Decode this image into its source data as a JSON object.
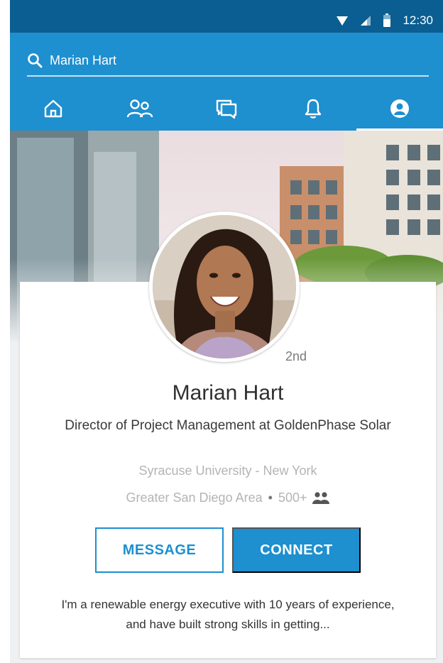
{
  "status_bar": {
    "time": "12:30",
    "icons": [
      "wifi-icon",
      "signal-icon",
      "battery-icon"
    ]
  },
  "search": {
    "value": "Marian Hart",
    "icon": "search-icon"
  },
  "nav": {
    "items": [
      {
        "icon": "home-icon"
      },
      {
        "icon": "people-icon"
      },
      {
        "icon": "messages-icon"
      },
      {
        "icon": "notifications-icon"
      },
      {
        "icon": "profile-icon",
        "active": true
      }
    ]
  },
  "profile": {
    "connection_degree": "2nd",
    "name": "Marian Hart",
    "headline": "Director of Project Management at GoldenPhase Solar",
    "education_location": "Syracuse University - New York",
    "area": "Greater San Diego Area",
    "separator": "•",
    "connections": "500+",
    "connections_icon": "connections-icon",
    "summary": "I'm a renewable energy executive with 10 years of experience, and have built strong skills in getting..."
  },
  "actions": {
    "message_label": "MESSAGE",
    "connect_label": "CONNECT"
  },
  "colors": {
    "status_bar": "#0a5e91",
    "header": "#1e8fcf",
    "accent": "#1e8fcf",
    "name_text": "#2f2f2f",
    "muted_text": "#b4b4b4"
  }
}
